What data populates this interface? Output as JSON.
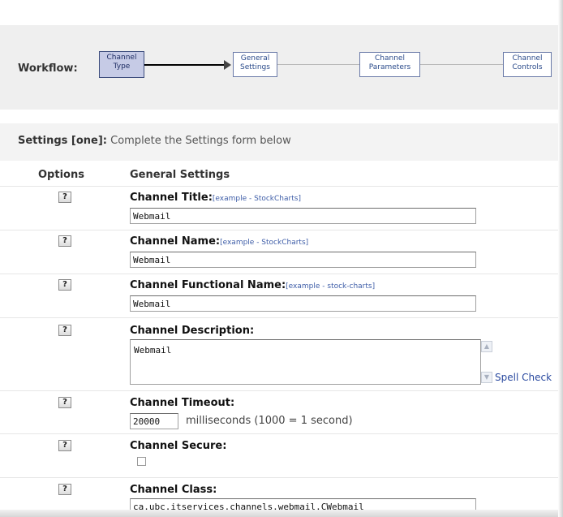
{
  "workflow": {
    "label": "Workflow:",
    "steps": [
      {
        "line1": "Channel",
        "line2": "Type"
      },
      {
        "line1": "General",
        "line2": "Settings"
      },
      {
        "line1": "Channel",
        "line2": "Parameters"
      },
      {
        "line1": "Channel",
        "line2": "Controls"
      }
    ]
  },
  "settings": {
    "heading_bold": "Settings [one]:",
    "heading_text": " Complete the Settings form below",
    "col_options": "Options",
    "col_general": "General Settings"
  },
  "help_label": "?",
  "fields": {
    "title": {
      "label": "Channel Title:",
      "example": "[example - StockCharts]",
      "value": "Webmail"
    },
    "name": {
      "label": "Channel Name:",
      "example": "[example - StockCharts]",
      "value": "Webmail"
    },
    "fname": {
      "label": "Channel Functional Name:",
      "example": "[example - stock-charts]",
      "value": "Webmail"
    },
    "description": {
      "label": "Channel Description:",
      "value": "Webmail",
      "spell_check": "Spell Check"
    },
    "timeout": {
      "label": "Channel Timeout:",
      "value": "20000",
      "unit": "milliseconds (1000 = 1 second)"
    },
    "secure": {
      "label": "Channel Secure:"
    },
    "class": {
      "label": "Channel Class:",
      "value": "ca.ubc.itservices.channels.webmail.CWebmail"
    }
  },
  "icons": {
    "scroll_up": "▲",
    "scroll_down": "▼"
  }
}
